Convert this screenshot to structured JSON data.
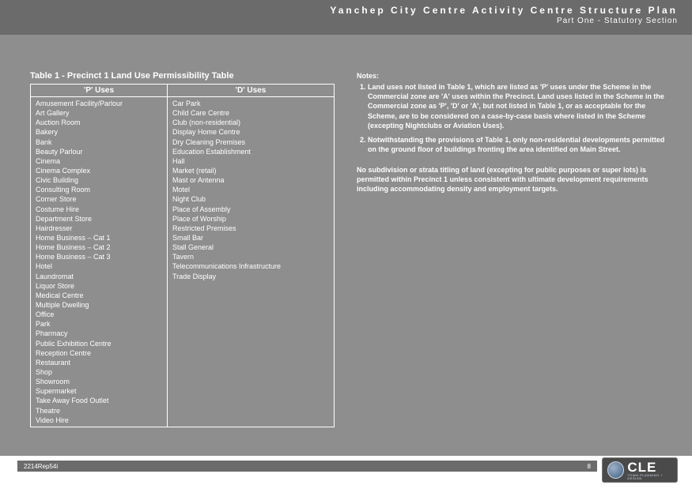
{
  "header": {
    "title": "Yanchep City Centre Activity Centre Structure Plan",
    "subtitle": "Part One - Statutory Section"
  },
  "table": {
    "title": "Table 1 - Precinct 1 Land Use Permissibility Table",
    "col_p_header": "'P' Uses",
    "col_d_header": "'D' Uses",
    "p_uses": [
      "Amusement Facility/Parlour",
      "Art Gallery",
      "Auction Room",
      "Bakery",
      "Bank",
      "Beauty Parlour",
      "Cinema",
      "Cinema Complex",
      "Civic Building",
      "Consulting Room",
      "Corner Store",
      "Costume Hire",
      "Department Store",
      "Hairdresser",
      "Home Business – Cat 1",
      "Home Business – Cat 2",
      "Home Business – Cat 3",
      "Hotel",
      "Laundromat",
      "Liquor Store",
      "Medical Centre",
      "Multiple Dwelling",
      "Office",
      "Park",
      "Pharmacy",
      "Public Exhibition Centre",
      "Reception Centre",
      "Restaurant",
      "Shop",
      "Showroom",
      "Supermarket",
      "Take Away Food Outlet",
      "Theatre",
      "Video Hire"
    ],
    "d_uses": [
      "Car Park",
      "Child Care Centre",
      "Club (non-residential)",
      "Display Home Centre",
      "Dry Cleaning Premises",
      "Education Establishment",
      "Hall",
      "Market (retail)",
      "Mast or Antenna",
      "Motel",
      "Night Club",
      "Place of Assembly",
      "Place of Worship",
      "Restricted Premises",
      "Small Bar",
      "Stall General",
      "Tavern",
      "Telecommunications Infrastructure",
      "Trade Display"
    ]
  },
  "notes": {
    "heading": "Notes:",
    "items": [
      "Land uses not listed in Table 1, which are listed as 'P' uses under the Scheme in the Commercial zone are 'A' uses within the Precinct.  Land uses listed in the Scheme in the Commercial zone as 'P', 'D' or 'A', but not listed in Table 1, or as acceptable for the Scheme, are to be considered on a case-by-case basis where listed in the Scheme (excepting Nightclubs or Aviation Uses).",
      "Notwithstanding the provisions of Table 1, only non-residential developments permitted on the ground floor of buildings fronting the area identified on Main Street."
    ]
  },
  "subdivision_text": "No subdivision or strata titling of land (excepting for public purposes or super lots) is permitted within Precinct 1 unless consistent with ultimate development requirements including accommodating density and employment targets.",
  "footer": {
    "ref": "2214Rep54i",
    "page": "8"
  },
  "logo": {
    "big": "CLE",
    "small": "TOWN PLANNING + DESIGN"
  }
}
